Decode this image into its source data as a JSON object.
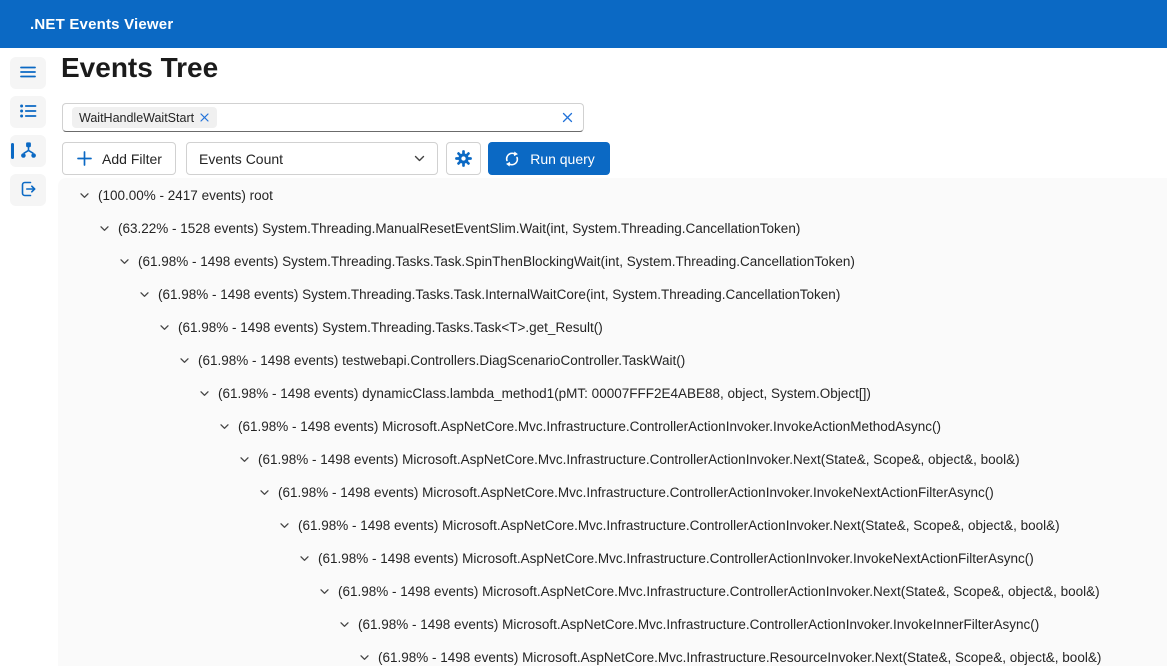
{
  "app": {
    "title": ".NET Events Viewer"
  },
  "page": {
    "title": "Events Tree"
  },
  "colors": {
    "accent": "#0b69c4",
    "appbar_background": "#0b69c4",
    "tree_panel_background": "#fafafa",
    "control_border": "#d1d1d1",
    "text": "#242424"
  },
  "sidebar": {
    "items": [
      {
        "icon": "hamburger-menu-icon",
        "selected": false
      },
      {
        "icon": "bulleted-list-icon",
        "selected": false
      },
      {
        "icon": "events-tree-icon",
        "selected": true
      },
      {
        "icon": "exit-icon",
        "selected": false
      }
    ]
  },
  "filter": {
    "chip": {
      "label": "WaitHandleWaitStart",
      "remove_icon": "✕"
    },
    "clear_icon": "✕"
  },
  "toolbar": {
    "add_filter_label": "Add Filter",
    "add_icon": "+",
    "query_type_value": "Events Count",
    "query_type_chevron": "⌄",
    "gear_icon": "⚙",
    "run_query_label": "Run query",
    "run_query_icon": "⟳"
  },
  "tree": {
    "rows": [
      {
        "depth": 0,
        "percent": "100.00%",
        "events": "2417",
        "method": "root"
      },
      {
        "depth": 1,
        "percent": "63.22%",
        "events": "1528",
        "method": "System.Threading.ManualResetEventSlim.Wait(int, System.Threading.CancellationToken)"
      },
      {
        "depth": 2,
        "percent": "61.98%",
        "events": "1498",
        "method": "System.Threading.Tasks.Task.SpinThenBlockingWait(int, System.Threading.CancellationToken)"
      },
      {
        "depth": 3,
        "percent": "61.98%",
        "events": "1498",
        "method": "System.Threading.Tasks.Task.InternalWaitCore(int, System.Threading.CancellationToken)"
      },
      {
        "depth": 4,
        "percent": "61.98%",
        "events": "1498",
        "method": "System.Threading.Tasks.Task<T>.get_Result()"
      },
      {
        "depth": 5,
        "percent": "61.98%",
        "events": "1498",
        "method": "testwebapi.Controllers.DiagScenarioController.TaskWait()"
      },
      {
        "depth": 6,
        "percent": "61.98%",
        "events": "1498",
        "method": "dynamicClass.lambda_method1(pMT: 00007FFF2E4ABE88, object, System.Object[])"
      },
      {
        "depth": 7,
        "percent": "61.98%",
        "events": "1498",
        "method": "Microsoft.AspNetCore.Mvc.Infrastructure.ControllerActionInvoker.InvokeActionMethodAsync()"
      },
      {
        "depth": 8,
        "percent": "61.98%",
        "events": "1498",
        "method": "Microsoft.AspNetCore.Mvc.Infrastructure.ControllerActionInvoker.Next(State&, Scope&, object&, bool&)"
      },
      {
        "depth": 9,
        "percent": "61.98%",
        "events": "1498",
        "method": "Microsoft.AspNetCore.Mvc.Infrastructure.ControllerActionInvoker.InvokeNextActionFilterAsync()"
      },
      {
        "depth": 10,
        "percent": "61.98%",
        "events": "1498",
        "method": "Microsoft.AspNetCore.Mvc.Infrastructure.ControllerActionInvoker.Next(State&, Scope&, object&, bool&)"
      },
      {
        "depth": 11,
        "percent": "61.98%",
        "events": "1498",
        "method": "Microsoft.AspNetCore.Mvc.Infrastructure.ControllerActionInvoker.InvokeNextActionFilterAsync()"
      },
      {
        "depth": 12,
        "percent": "61.98%",
        "events": "1498",
        "method": "Microsoft.AspNetCore.Mvc.Infrastructure.ControllerActionInvoker.Next(State&, Scope&, object&, bool&)"
      },
      {
        "depth": 13,
        "percent": "61.98%",
        "events": "1498",
        "method": "Microsoft.AspNetCore.Mvc.Infrastructure.ControllerActionInvoker.InvokeInnerFilterAsync()"
      },
      {
        "depth": 14,
        "percent": "61.98%",
        "events": "1498",
        "method": "Microsoft.AspNetCore.Mvc.Infrastructure.ResourceInvoker.Next(State&, Scope&, object&, bool&)"
      }
    ]
  }
}
